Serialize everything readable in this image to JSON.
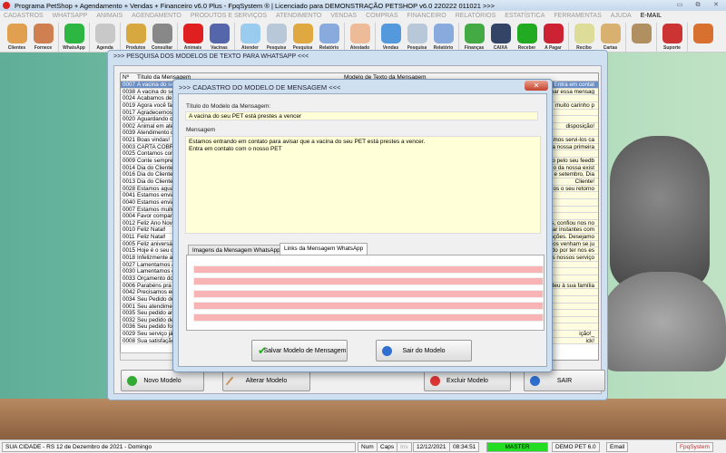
{
  "window_title": "Programa PetShop + Agendamento + Vendas + Financeiro v6.0 Plus - FpqSystem ® | Licenciado para  DEMONSTRAÇÃO PETSHOP v6.0 220222 011021 >>>",
  "menu": [
    "CADASTROS",
    "WHATSAPP",
    "ANIMAIS",
    "AGENDAMENTO",
    "PRODUTOS E SERVIÇOS",
    "ATENDIMENTO",
    "VENDAS",
    "COMPRAS",
    "FINANCEIRO",
    "RELATÓRIOS",
    "ESTATÍSTICA",
    "FERRAMENTAS",
    "AJUDA",
    "E-MAIL"
  ],
  "toolbar": [
    {
      "label": "Clientes",
      "icon": "clients-icon",
      "color": "#e0a050"
    },
    {
      "label": "Fornece",
      "icon": "supplier-icon",
      "color": "#d08050"
    },
    {
      "label": "WhatsApp",
      "icon": "whatsapp-icon",
      "color": "#2db742"
    },
    {
      "label": "Agenda",
      "icon": "calendar-icon",
      "color": "#c8c8c8"
    },
    {
      "label": "Produtos",
      "icon": "boxes-icon",
      "color": "#d8a840"
    },
    {
      "label": "Consultar",
      "icon": "barcode-icon",
      "color": "#888"
    },
    {
      "label": "Animais",
      "icon": "paw-icon",
      "color": "#e02020"
    },
    {
      "label": "Vacinas",
      "icon": "syringe-icon",
      "color": "#5566aa"
    },
    {
      "label": "Atender",
      "icon": "paw-plus-icon",
      "color": "#99ccee"
    },
    {
      "label": "Pesquisa",
      "icon": "search-doc-icon",
      "color": "#b8c8d8"
    },
    {
      "label": "Pesquisa",
      "icon": "folder-icon",
      "color": "#e0a840"
    },
    {
      "label": "Relatório",
      "icon": "printer-icon",
      "color": "#88aadd"
    },
    {
      "label": "Atestado",
      "icon": "certificate-icon",
      "color": "#eebb99"
    },
    {
      "label": "Vendas",
      "icon": "monitor-icon",
      "color": "#5599dd"
    },
    {
      "label": "Pesquisa",
      "icon": "search-doc-icon",
      "color": "#b8c8d8"
    },
    {
      "label": "Relatório",
      "icon": "printer-icon",
      "color": "#88aadd"
    },
    {
      "label": "Finanças",
      "icon": "finance-chart-icon",
      "color": "#44aa44"
    },
    {
      "label": "CAIXA",
      "icon": "cash-book-icon",
      "color": "#334466"
    },
    {
      "label": "Receber",
      "icon": "dollar-green-icon",
      "color": "#22aa22"
    },
    {
      "label": "A Pagar",
      "icon": "dollar-red-icon",
      "color": "#cc2233"
    },
    {
      "label": "Recibo",
      "icon": "receipt-icon",
      "color": "#dddd99"
    },
    {
      "label": "Cartas",
      "icon": "scroll-icon",
      "color": "#d8b070"
    },
    {
      "label": "",
      "icon": "coins-icon",
      "color": "#b09060"
    },
    {
      "label": "Suporte",
      "icon": "support-icon",
      "color": "#cc3333"
    },
    {
      "label": "",
      "icon": "exit-door-icon",
      "color": "#d87030"
    }
  ],
  "search_window": {
    "title": ">>> PESQUISA DOS MODELOS DE TEXTO PARA WHATSAPP <<<",
    "columns": [
      "Nº",
      "Título da Mensagem",
      "Modelo de Texto da Mensagem"
    ],
    "rows": [
      [
        "0007",
        "A vacina do se",
        "Entra em contat"
      ],
      [
        "0038",
        "A vacina do se",
        "mar essa mensag"
      ],
      [
        "0024",
        "Acabamos de",
        ""
      ],
      [
        "0019",
        "Agora você fa",
        "muito carinho p"
      ],
      [
        "0017",
        "Agradecemos",
        ""
      ],
      [
        "0020",
        "Aguardando o",
        ""
      ],
      [
        "0002",
        "Animal em ate",
        "disposição!"
      ],
      [
        "0039",
        "Atendimento d",
        ""
      ],
      [
        "0021",
        "Boas vindas!",
        "amos servi-los ca"
      ],
      [
        "0003",
        "CARTA COBR",
        "a nossa primeira"
      ],
      [
        "0025",
        "Contamos com",
        ""
      ],
      [
        "0009",
        "Conte sempre",
        "o pelo seu feedb"
      ],
      [
        "0014",
        "Dia do Cliente",
        "o da nossa exist"
      ],
      [
        "0016",
        "Dia do Cliente",
        "e setembro, Dia"
      ],
      [
        "0013",
        "Dia do Cliente",
        "Cliente!"
      ],
      [
        "0028",
        "Estamos aguar",
        "os o seu retorno"
      ],
      [
        "0041",
        "Estamos envia",
        ""
      ],
      [
        "0040",
        "Estamos envia",
        ""
      ],
      [
        "0007",
        "Estamos muito",
        ""
      ],
      [
        "0004",
        "Favor compare",
        ""
      ],
      [
        "0012",
        "Feliz Ano Novo",
        "s, confiou nos no"
      ],
      [
        "0010",
        "Feliz Natal!",
        "har instantes com"
      ],
      [
        "0011",
        "Feliz Natal!",
        "ações. Desejamo"
      ],
      [
        "0005",
        "Feliz aniversári",
        "gos venham se ju"
      ],
      [
        "0015",
        "Hoje é o seu d",
        "do por ter nos es"
      ],
      [
        "0018",
        "Infelizmente a",
        "os nossos serviço"
      ],
      [
        "0027",
        "Lamentamos a",
        ""
      ],
      [
        "0030",
        "Lamentamos o",
        ""
      ],
      [
        "0033",
        "Orçamento do",
        ""
      ],
      [
        "0006",
        "Parabéns pra v",
        "deu à sua família"
      ],
      [
        "0042",
        "Precisamos en",
        ""
      ],
      [
        "0034",
        "Seu Pedido de",
        ""
      ],
      [
        "0001",
        "Seu atendimen",
        ""
      ],
      [
        "0035",
        "Seu pedido an",
        ""
      ],
      [
        "0032",
        "Seu pedido de",
        ""
      ],
      [
        "0036",
        "Seu pedido fo",
        ""
      ],
      [
        "0029",
        "Seu serviço já",
        "ição!_"
      ],
      [
        "0008",
        "Sua satisfação",
        "ick!"
      ]
    ],
    "buttons": {
      "new": "Novo Modelo",
      "edit": "Alterar Modelo",
      "delete": "Excluir Modelo",
      "exit": "SAIR"
    }
  },
  "modal": {
    "title": ">>> CADASTRO DO MODELO DE MENSAGEM <<<",
    "title_label": "Título do Modelo da Mensagem:",
    "title_value": "A vacina do seu PET está prestes a vencer",
    "message_label": "Mensagem",
    "message_value": "Estamos entrando em contato para avisar que a vacina do seu PET está prestes a vencer.\nEntra em contato com o nosso PET",
    "tabs": [
      "Imagens da Mensagem WhatsApp",
      "Links da Mensagem WhatsApp"
    ],
    "active_tab": 1,
    "link_fields": [
      "",
      "",
      "",
      "",
      ""
    ],
    "save_label": "Salvar Modelo de Mensagem",
    "exit_label": "Sair do Modelo"
  },
  "status": {
    "location": "SUA CIDADE - RS 12 de Dezembro de 2021 - Domingo",
    "num": "Num",
    "caps": "Caps",
    "ins": "Ins",
    "date": "12/12/2021",
    "time": "08:34:51",
    "user": "MASTER",
    "company": "DEMO PET 6.0",
    "email": "Email",
    "brand": "FpqSystem"
  },
  "colors": {
    "selected_row": "#6b8fc4",
    "field_bg": "#ffffd8",
    "link_field": "#f8b4b4",
    "user_badge": "#22dd22"
  }
}
